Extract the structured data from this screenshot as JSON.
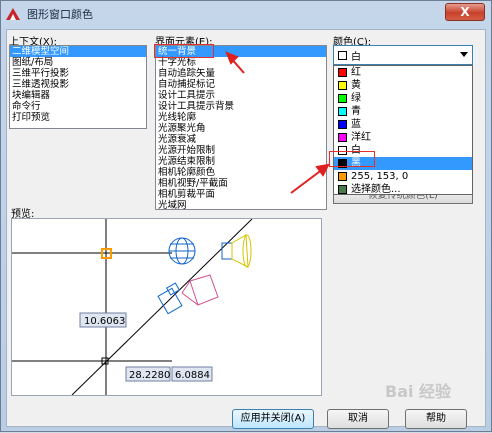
{
  "window": {
    "title": "图形窗口颜色",
    "close_glyph": "X"
  },
  "context": {
    "label": "上下文(X):",
    "items": [
      "二维模型空间",
      "图纸/布局",
      "三维平行投影",
      "三维透视投影",
      "块编辑器",
      "命令行",
      "打印预览"
    ],
    "selected_index": 0
  },
  "interface": {
    "label": "界面元素(E):",
    "items": [
      "统一背景",
      "十字光标",
      "自动追踪矢量",
      "自动捕捉标记",
      "设计工具提示",
      "设计工具提示背景",
      "光线轮廓",
      "光源聚光角",
      "光源衰减",
      "光源开始限制",
      "光源结束限制",
      "相机轮廓颜色",
      "相机视野/平截面",
      "相机剪裁平面",
      "光域网"
    ],
    "selected_index": 0
  },
  "color": {
    "label": "颜色(C):",
    "current_value": "白",
    "current_swatch": "#ffffff",
    "options": [
      {
        "label": "红",
        "swatch": "#ff0000"
      },
      {
        "label": "黄",
        "swatch": "#ffff00"
      },
      {
        "label": "绿",
        "swatch": "#00ff00"
      },
      {
        "label": "青",
        "swatch": "#00ffff"
      },
      {
        "label": "蓝",
        "swatch": "#0000ff"
      },
      {
        "label": "洋红",
        "swatch": "#ff00ff"
      },
      {
        "label": "白",
        "swatch": "#ffffff"
      },
      {
        "label": "黑",
        "swatch": "#000000"
      },
      {
        "label": "255, 153, 0",
        "swatch": "#ff9900"
      },
      {
        "label": "选择颜色...",
        "swatch": "#4a7a4a"
      }
    ],
    "highlighted_index": 7,
    "restore_button": "恢复传统颜色(L)"
  },
  "preview": {
    "label": "预览:",
    "tooltip_a": "10.6063",
    "tooltip_b": "28.2280",
    "tooltip_c": "6.0884",
    "marker_color": "#ff9900"
  },
  "buttons": {
    "apply": "应用并关闭(A)",
    "cancel": "取消",
    "help": "帮助"
  },
  "watermark": "Bai 经验"
}
